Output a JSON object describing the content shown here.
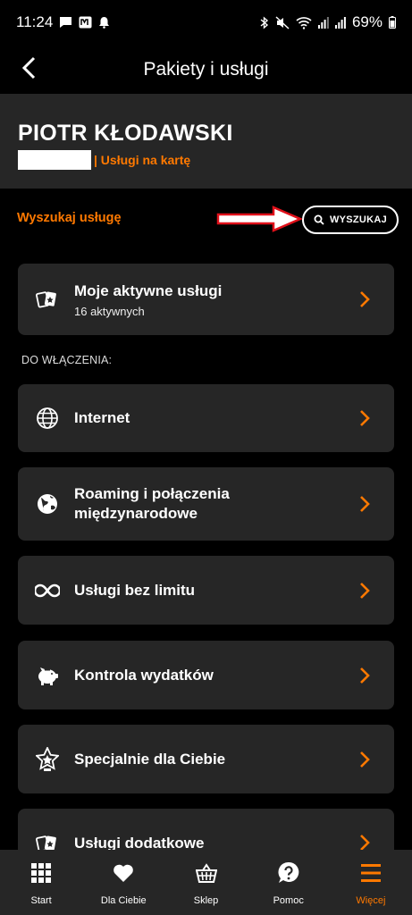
{
  "status": {
    "time": "11:24",
    "battery": "69%"
  },
  "appbar": {
    "title": "Pakiety i usługi"
  },
  "profile": {
    "name": "PIOTR KŁODAWSKI",
    "plan": "| Usługi na kartę"
  },
  "search": {
    "label": "Wyszukaj usługę",
    "button": "WYSZUKAJ"
  },
  "active_services": {
    "title": "Moje aktywne usługi",
    "subtitle": "16 aktywnych"
  },
  "section_label": "DO WŁĄCZENIA:",
  "services": [
    {
      "label": "Internet",
      "icon": "globe-icon"
    },
    {
      "label": "Roaming i połączenia międzynarodowe",
      "icon": "earth-icon"
    },
    {
      "label": "Usługi bez limitu",
      "icon": "infinity-icon"
    },
    {
      "label": "Kontrola wydatków",
      "icon": "piggy-bank-icon"
    },
    {
      "label": "Specjalnie dla Ciebie",
      "icon": "star-badge-icon"
    },
    {
      "label": "Usługi dodatkowe",
      "icon": "cards-icon"
    }
  ],
  "nav": [
    {
      "label": "Start",
      "icon": "grid-icon"
    },
    {
      "label": "Dla Ciebie",
      "icon": "heart-icon"
    },
    {
      "label": "Sklep",
      "icon": "basket-icon"
    },
    {
      "label": "Pomoc",
      "icon": "help-bubble-icon"
    },
    {
      "label": "Więcej",
      "icon": "menu-icon",
      "active": true
    }
  ],
  "colors": {
    "accent": "#ff7900",
    "card": "#262626",
    "background": "#000000",
    "annotation_arrow": "#e0101a"
  }
}
